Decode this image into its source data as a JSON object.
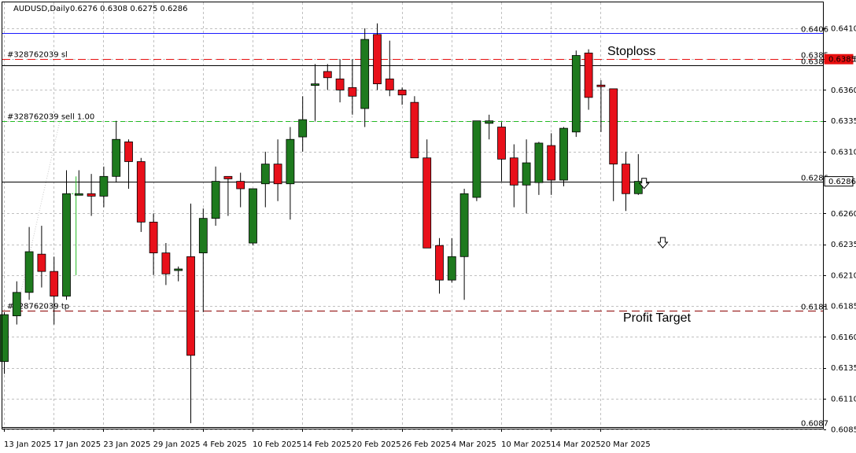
{
  "header": {
    "title": "AUDUSD,Daily",
    "ohlc": "0.6276 0.6308 0.6275 0.6286"
  },
  "colors": {
    "bull": "#1e7a1e",
    "bear": "#e8101a",
    "grid": "#c0c0c0",
    "sl": "#e81010",
    "tp": "#8b0000",
    "top": "#1a1aff",
    "entry": "#22bb22"
  },
  "chart_data": {
    "type": "candlestick",
    "symbol": "AUDUSD",
    "timeframe": "Daily",
    "ylim": [
      0.608,
      0.642
    ],
    "y_ticks": [
      "0.6410",
      "0.6385",
      "0.6360",
      "0.6335",
      "0.6310",
      "0.6286",
      "0.6260",
      "0.6235",
      "0.6210",
      "0.6185",
      "0.6160",
      "0.6135",
      "0.6110",
      "0.6085"
    ],
    "x_ticks": [
      {
        "index": 0,
        "label": "13 Jan 2025"
      },
      {
        "index": 4,
        "label": "17 Jan 2025"
      },
      {
        "index": 8,
        "label": "23 Jan 2025"
      },
      {
        "index": 12,
        "label": "29 Jan 2025"
      },
      {
        "index": 16,
        "label": "4 Feb 2025"
      },
      {
        "index": 20,
        "label": "10 Feb 2025"
      },
      {
        "index": 24,
        "label": "14 Feb 2025"
      },
      {
        "index": 28,
        "label": "20 Feb 2025"
      },
      {
        "index": 32,
        "label": "26 Feb 2025"
      },
      {
        "index": 36,
        "label": "4 Mar 2025"
      },
      {
        "index": 40,
        "label": "10 Mar 2025"
      },
      {
        "index": 44,
        "label": "14 Mar 2025"
      },
      {
        "index": 48,
        "label": "20 Mar 2025"
      }
    ],
    "candles": [
      [
        0.614,
        0.618,
        0.613,
        0.6178
      ],
      [
        0.6177,
        0.6205,
        0.617,
        0.6196
      ],
      [
        0.6196,
        0.6249,
        0.619,
        0.6229
      ],
      [
        0.6227,
        0.625,
        0.62,
        0.6213
      ],
      [
        0.6213,
        0.6225,
        0.617,
        0.6193
      ],
      [
        0.6193,
        0.6295,
        0.619,
        0.6276
      ],
      [
        0.6275,
        0.6295,
        0.6275,
        0.6276
      ],
      [
        0.6276,
        0.6292,
        0.6258,
        0.6274
      ],
      [
        0.6274,
        0.6298,
        0.6265,
        0.629
      ],
      [
        0.629,
        0.6335,
        0.6285,
        0.632
      ],
      [
        0.6318,
        0.632,
        0.628,
        0.6302
      ],
      [
        0.6302,
        0.6305,
        0.6245,
        0.6253
      ],
      [
        0.6253,
        0.626,
        0.621,
        0.6228
      ],
      [
        0.6228,
        0.6236,
        0.6202,
        0.6211
      ],
      [
        0.6214,
        0.6217,
        0.6205,
        0.6215
      ],
      [
        0.6225,
        0.6268,
        0.609,
        0.6145
      ],
      [
        0.6228,
        0.6264,
        0.618,
        0.6256
      ],
      [
        0.6256,
        0.6298,
        0.625,
        0.6286
      ],
      [
        0.629,
        0.629,
        0.6258,
        0.6288
      ],
      [
        0.6286,
        0.6293,
        0.6265,
        0.628
      ],
      [
        0.6236,
        0.6273,
        0.6234,
        0.628
      ],
      [
        0.6284,
        0.631,
        0.6265,
        0.63
      ],
      [
        0.63,
        0.632,
        0.627,
        0.6284
      ],
      [
        0.6284,
        0.633,
        0.6255,
        0.632
      ],
      [
        0.6322,
        0.6355,
        0.631,
        0.6336
      ],
      [
        0.6365,
        0.6381,
        0.6335,
        0.6365
      ],
      [
        0.6375,
        0.6381,
        0.636,
        0.637
      ],
      [
        0.6369,
        0.6385,
        0.635,
        0.636
      ],
      [
        0.6362,
        0.6385,
        0.634,
        0.6355
      ],
      [
        0.6345,
        0.641,
        0.633,
        0.6401
      ],
      [
        0.6405,
        0.6414,
        0.636,
        0.6365
      ],
      [
        0.6369,
        0.64,
        0.6355,
        0.636
      ],
      [
        0.636,
        0.6362,
        0.6348,
        0.6356
      ],
      [
        0.635,
        0.6355,
        0.632,
        0.6305
      ],
      [
        0.6305,
        0.632,
        0.6232,
        0.6232
      ],
      [
        0.6234,
        0.624,
        0.6195,
        0.6206
      ],
      [
        0.6206,
        0.624,
        0.6204,
        0.6225
      ],
      [
        0.6225,
        0.628,
        0.619,
        0.6276
      ],
      [
        0.6273,
        0.6335,
        0.627,
        0.6335
      ],
      [
        0.6333,
        0.634,
        0.632,
        0.6335
      ],
      [
        0.633,
        0.6334,
        0.6286,
        0.6304
      ],
      [
        0.6305,
        0.6316,
        0.6265,
        0.6283
      ],
      [
        0.6283,
        0.632,
        0.626,
        0.6301
      ],
      [
        0.6285,
        0.6318,
        0.6275,
        0.6317
      ],
      [
        0.6315,
        0.6325,
        0.6275,
        0.6287
      ],
      [
        0.6287,
        0.633,
        0.6282,
        0.6329
      ],
      [
        0.6326,
        0.6392,
        0.6322,
        0.6388
      ],
      [
        0.639,
        0.6393,
        0.6344,
        0.6354
      ],
      [
        0.6364,
        0.6368,
        0.6326,
        0.6363
      ],
      [
        0.6361,
        0.636,
        0.627,
        0.63
      ],
      [
        0.63,
        0.631,
        0.6262,
        0.6276
      ],
      [
        0.6276,
        0.6308,
        0.6275,
        0.6286
      ]
    ],
    "horizontal_lines": [
      {
        "name": "high-line",
        "price": 0.6406,
        "label": "0.6406",
        "style": "solid",
        "color": "#1a1aff"
      },
      {
        "name": "stoploss-line",
        "price": 0.6385,
        "label": "0.6385",
        "style": "dashed",
        "color": "#e81010",
        "order_label": "#328762039 sl"
      },
      {
        "name": "resistance-line",
        "price": 0.638,
        "label": "0.6380",
        "style": "solid",
        "color": "#000000"
      },
      {
        "name": "entry-line",
        "price": 0.6335,
        "style": "dashed",
        "color": "#22bb22",
        "order_label": "#328762039 sell 1.00"
      },
      {
        "name": "current-price-line",
        "price": 0.6286,
        "label": "0.6286",
        "style": "solid",
        "color": "#000000"
      },
      {
        "name": "take-profit-line",
        "price": 0.6181,
        "label": "0.6181",
        "style": "dashed",
        "color": "#8b0000",
        "order_label": "#328762039 tp"
      },
      {
        "name": "low-line",
        "price": 0.6087,
        "label": "0.6087",
        "style": "solid",
        "color": "#000000"
      }
    ],
    "annotations": [
      {
        "name": "stoploss-annotation",
        "text": "Stoploss",
        "price": 0.6392
      },
      {
        "name": "profit-target-annotation",
        "text": "Profit Target",
        "price": 0.6176
      }
    ],
    "arrows": [
      {
        "name": "sell-arrow-1",
        "index": 51.5,
        "price": 0.6284
      },
      {
        "name": "sell-arrow-2",
        "index": 53,
        "price": 0.6236
      }
    ],
    "price_tags": [
      {
        "name": "stoploss-price-tag",
        "text": "0.6385",
        "price": 0.6385,
        "bg": "#e81010",
        "fg": "#ffffff"
      },
      {
        "name": "current-price-tag",
        "text": "0.6286",
        "price": 0.6286,
        "bg": "#ffffff",
        "fg": "#000000"
      }
    ]
  }
}
